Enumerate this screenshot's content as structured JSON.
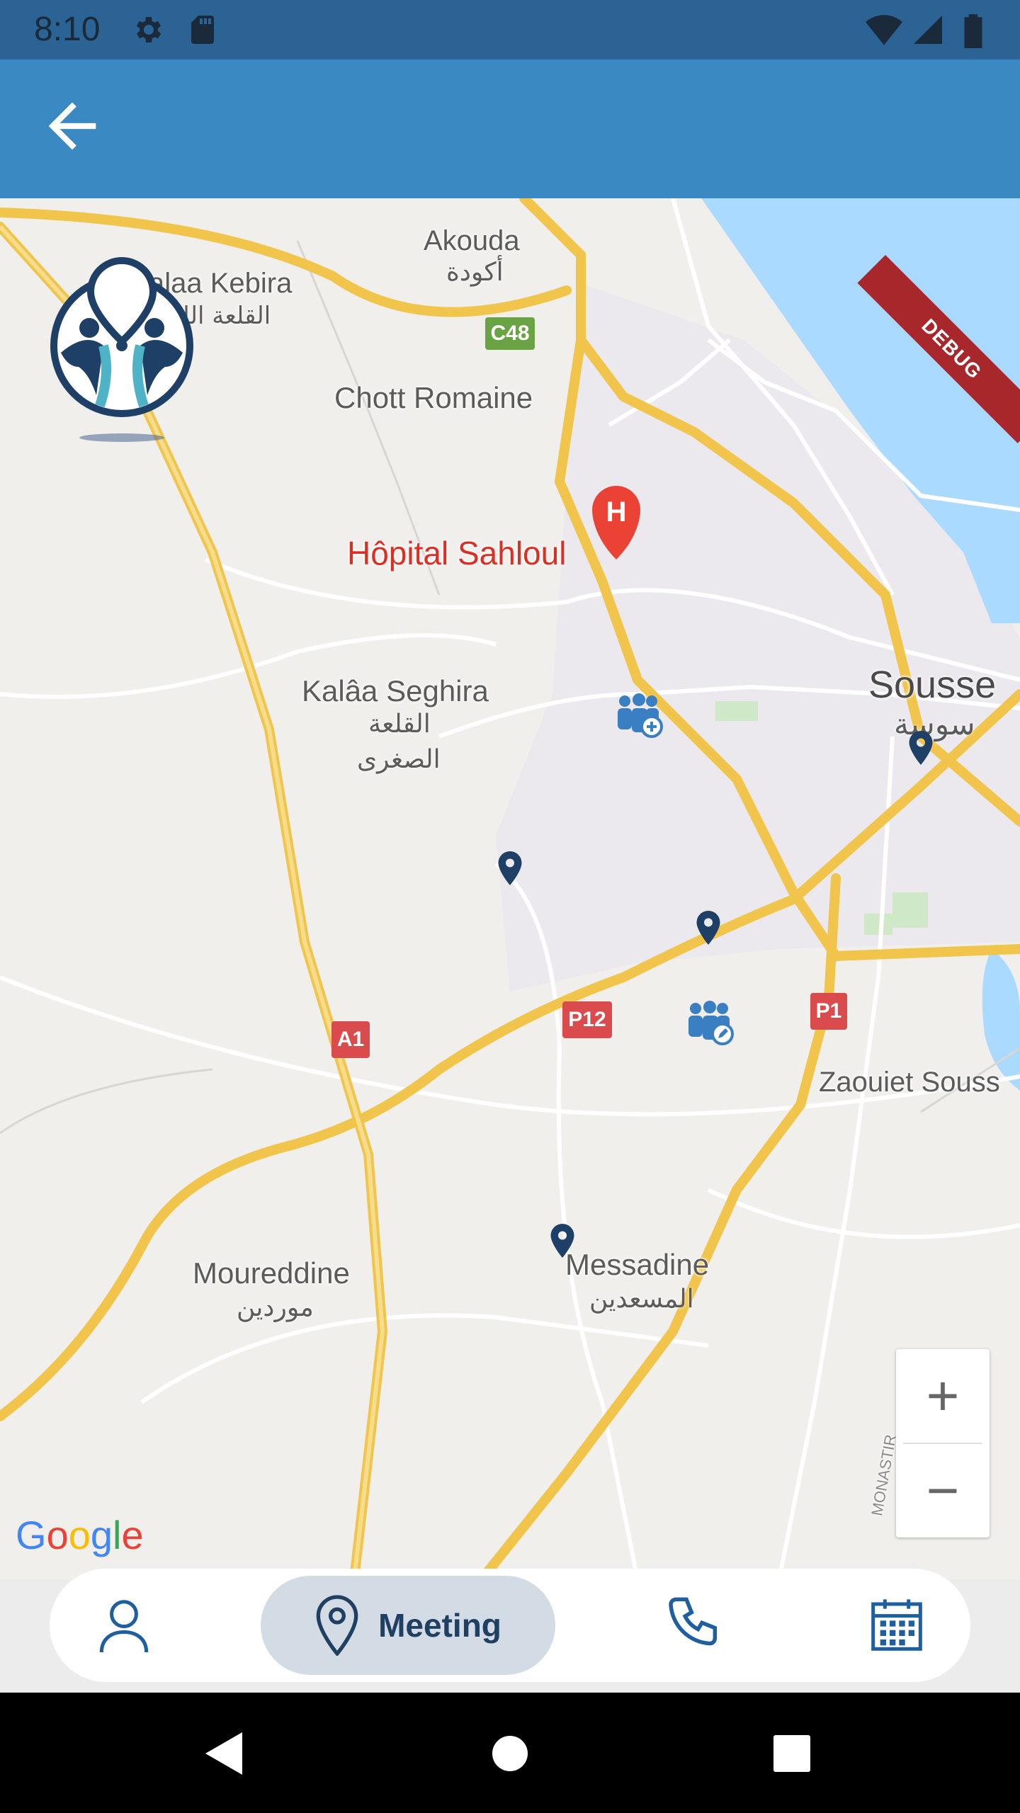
{
  "status_bar": {
    "time": "8:10"
  },
  "map": {
    "places": {
      "akouda": "Akouda",
      "akouda_ar": "أكودة",
      "kalaa_kebira": "alaa Kebira",
      "kalaa_kebira_ar": "القلعة الك",
      "chott_romaine": "Chott Romaine",
      "hopital": "Hôpital Sahloul",
      "kalaa_seghira": "Kalâa Seghira",
      "kalaa_seghira_ar1": "القلعة",
      "kalaa_seghira_ar2": "الصغرى",
      "sousse": "Sousse",
      "sousse_ar": "سوسة",
      "zaouiet": "Zaouiet Souss",
      "moureddine": "Moureddine",
      "moureddine_ar": "موردين",
      "messadine": "Messadine",
      "messadine_ar": "المسعدين",
      "monastir": "MONASTIR"
    },
    "road_shields": {
      "c48": "C48",
      "a1": "A1",
      "p12": "P12",
      "p1": "P1"
    },
    "zoom_in": "+",
    "zoom_out": "−",
    "attribution": "Google",
    "debug_banner": "DEBUG"
  },
  "bottom_nav": {
    "active_label": "Meeting"
  },
  "colors": {
    "app_bar": "#3a89c2",
    "status_bar": "#2b6394",
    "nav_accent": "#1f5fa0",
    "active_pill": "#d3dbe5"
  }
}
